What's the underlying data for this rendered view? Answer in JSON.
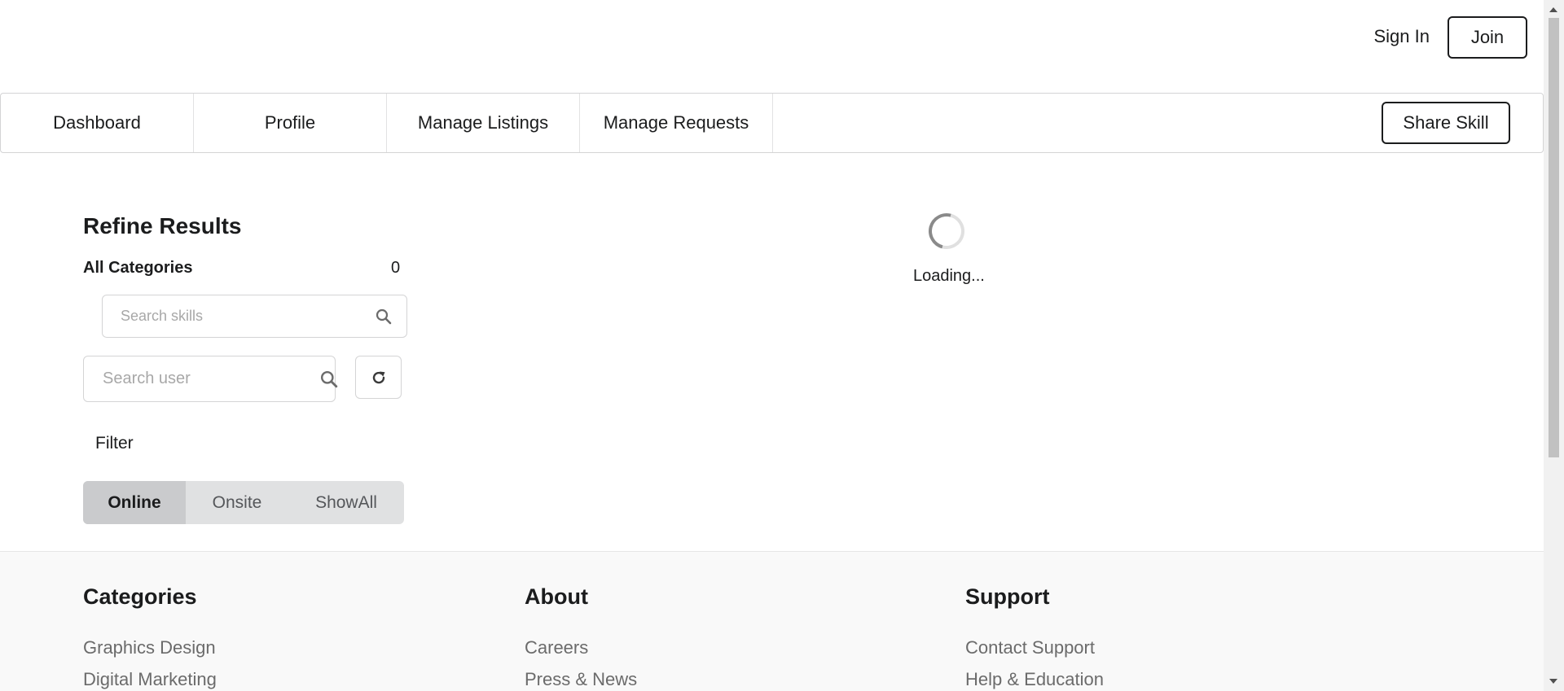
{
  "header": {
    "sign_in": "Sign In",
    "join": "Join"
  },
  "menu": {
    "items": [
      {
        "label": "Dashboard"
      },
      {
        "label": "Profile"
      },
      {
        "label": "Manage Listings"
      },
      {
        "label": "Manage Requests"
      }
    ],
    "share_skill": "Share Skill"
  },
  "sidebar": {
    "title": "Refine Results",
    "all_categories": "All Categories",
    "category_count": "0",
    "search_skills_placeholder": "Search skills",
    "search_user_placeholder": "Search user",
    "filter_label": "Filter",
    "filter_options": [
      "Online",
      "Onsite",
      "ShowAll"
    ],
    "active_filter": "Online"
  },
  "main": {
    "loading_text": "Loading..."
  },
  "footer": {
    "columns": [
      {
        "title": "Categories",
        "links": [
          "Graphics Design",
          "Digital Marketing"
        ]
      },
      {
        "title": "About",
        "links": [
          "Careers",
          "Press & News"
        ]
      },
      {
        "title": "Support",
        "links": [
          "Contact Support",
          "Help & Education"
        ]
      }
    ]
  },
  "icons": {
    "search": "search-icon",
    "refresh": "refresh-icon"
  },
  "colors": {
    "active_filter_bg": "#cacbcd",
    "filter_bg": "#e0e1e2",
    "footer_bg": "#f9f9f9"
  }
}
